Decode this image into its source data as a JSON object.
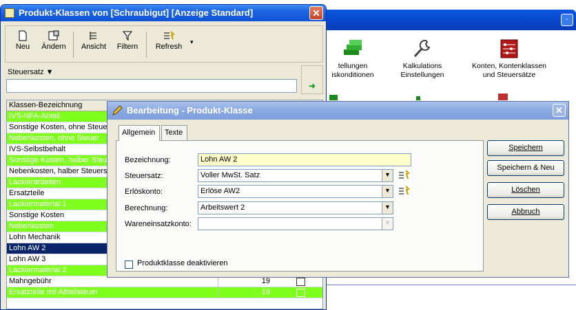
{
  "background": {
    "title_button": "-",
    "icons": [
      {
        "label_line1": "tellungen",
        "label_line2": "iskonditionen",
        "icon": "stack-icon"
      },
      {
        "label_line1": "Kalkulations",
        "label_line2": "Einstellungen",
        "icon": "wrench-icon"
      },
      {
        "label_line1": "Konten, Kontenklassen",
        "label_line2": "und Steuersätze",
        "icon": "abacus-icon"
      }
    ]
  },
  "list_window": {
    "title": "Produkt-Klassen von [Schraubigut] [Anzeige Standard]",
    "close_symbol": "✕",
    "toolbar": {
      "new": "Neu",
      "edit": "Ändern",
      "view": "Ansicht",
      "filter": "Filtern",
      "refresh": "Refresh"
    },
    "filter_label": "Steuersatz ▼",
    "filter_value": "",
    "columns": [
      "Klassen-Bezeichnung",
      "",
      ""
    ],
    "rows": [
      {
        "name": "IVS-NFA-Anteil",
        "value": "",
        "style": "green"
      },
      {
        "name": "Sonstige Kosten, ohne Steuer",
        "value": "",
        "style": "white"
      },
      {
        "name": "Nebenkosten, ohne Steuer",
        "value": "",
        "style": "green"
      },
      {
        "name": "IVS-Selbstbehalt",
        "value": "",
        "style": "white"
      },
      {
        "name": "Sonstige Kosten, halber Steuersatz",
        "value": "",
        "style": "green"
      },
      {
        "name": "Nebenkosten, halber Steuersatz",
        "value": "",
        "style": "white"
      },
      {
        "name": "Lackierarbeiten",
        "value": "",
        "style": "green"
      },
      {
        "name": "Ersatzteile",
        "value": "",
        "style": "white"
      },
      {
        "name": "Lackiermaterial 1",
        "value": "",
        "style": "green"
      },
      {
        "name": "Sonstige Kosten",
        "value": "",
        "style": "white"
      },
      {
        "name": "Nebenkosten",
        "value": "",
        "style": "green"
      },
      {
        "name": "Lohn Mechanik",
        "value": "",
        "style": "white"
      },
      {
        "name": "Lohn AW 2",
        "value": "",
        "style": "sel"
      },
      {
        "name": "Lohn AW 3",
        "value": "",
        "style": "white"
      },
      {
        "name": "Lackiermaterial 2",
        "value": "",
        "style": "green"
      },
      {
        "name": "Mahngebühr",
        "value": "19",
        "style": "white"
      },
      {
        "name": "Ersatzteile mit Altteilsteuer",
        "value": "19",
        "style": "green"
      }
    ]
  },
  "edit_dialog": {
    "title": "Bearbeitung - Produkt-Klasse",
    "close_symbol": "✕",
    "tabs": [
      "Allgemein",
      "Texte"
    ],
    "fields": {
      "bezeichnung_label": "Bezeichnung:",
      "bezeichnung_value": "Lohn AW 2",
      "steuersatz_label": "Steuersatz:",
      "steuersatz_value": "Voller MwSt. Satz",
      "erloeskonto_label": "Erlöskonto:",
      "erloeskonto_value": "Erlöse AW2",
      "berechnung_label": "Berechnung:",
      "berechnung_value": "Arbeitswert 2",
      "wareneinsatz_label": "Wareneinsatzkonto:",
      "wareneinsatz_value": ""
    },
    "checkbox_label": "Produktklasse deaktivieren",
    "buttons": {
      "save": "Speichern",
      "save_new": "Speichern & Neu",
      "delete": "Löschen",
      "cancel": "Abbruch"
    }
  }
}
